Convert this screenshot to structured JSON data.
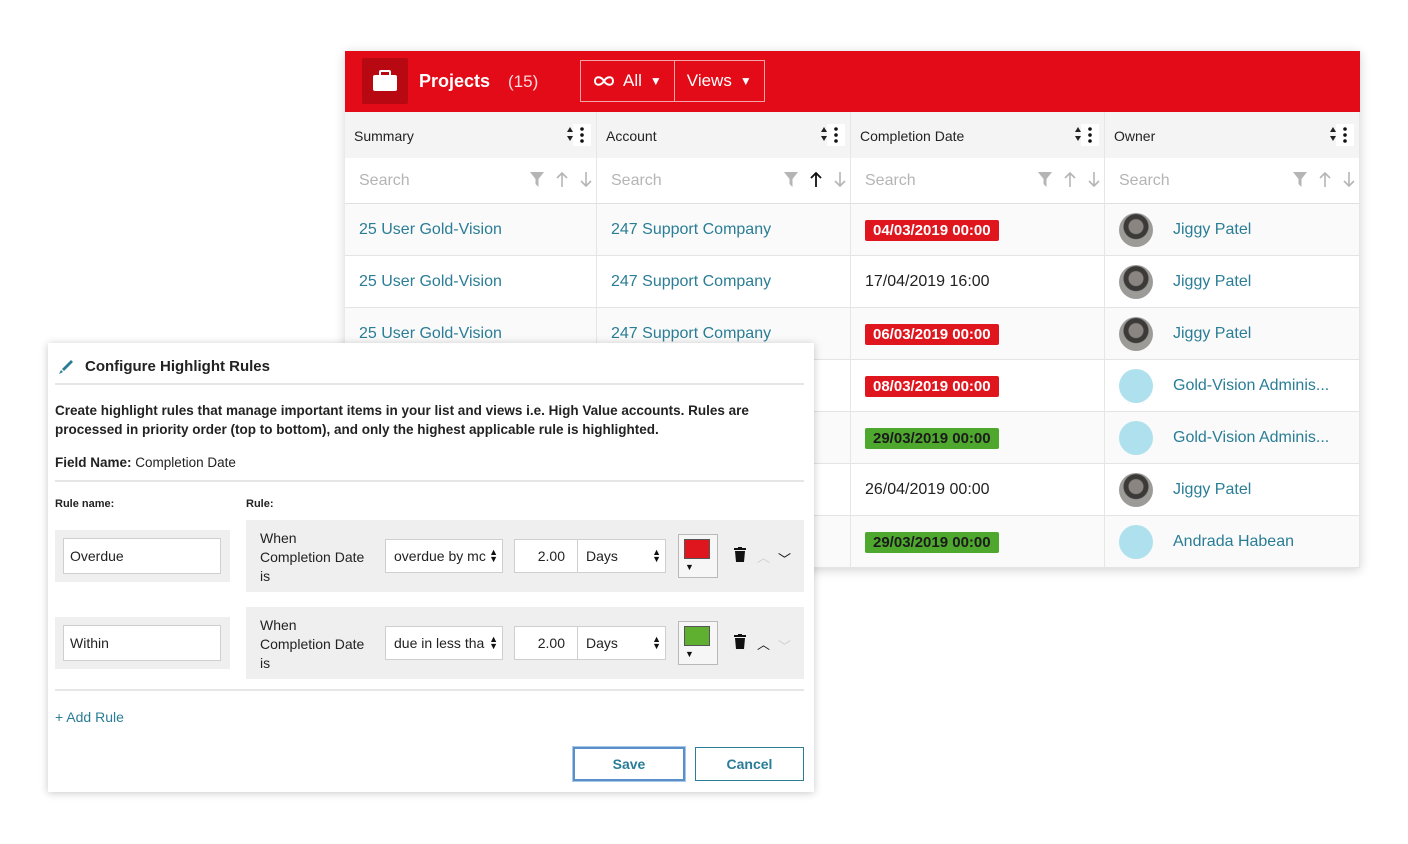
{
  "header": {
    "title": "Projects",
    "count": "(15)",
    "filter_label": "All",
    "views_label": "Views",
    "color": "#e20b17"
  },
  "columns": [
    {
      "label": "Summary",
      "search_placeholder": "Search"
    },
    {
      "label": "Account",
      "search_placeholder": "Search"
    },
    {
      "label": "Completion Date",
      "search_placeholder": "Search"
    },
    {
      "label": "Owner",
      "search_placeholder": "Search"
    }
  ],
  "rows": [
    {
      "summary": "25 User Gold-Vision",
      "account": "247 Support Company",
      "date": "04/03/2019 00:00",
      "highlight": "red",
      "owner": "Jiggy Patel",
      "avatar": "photo"
    },
    {
      "summary": "25 User Gold-Vision",
      "account": "247 Support Company",
      "date": "17/04/2019 16:00",
      "highlight": "none",
      "owner": "Jiggy Patel",
      "avatar": "photo"
    },
    {
      "summary": "25 User Gold-Vision",
      "account": "247 Support Company",
      "date": "06/03/2019 00:00",
      "highlight": "red",
      "owner": "Jiggy Patel",
      "avatar": "photo"
    },
    {
      "summary": "",
      "account": "",
      "date": "08/03/2019 00:00",
      "highlight": "red",
      "owner": "Gold-Vision Adminis...",
      "avatar": "blank"
    },
    {
      "summary": "",
      "account": "",
      "date": "29/03/2019 00:00",
      "highlight": "green",
      "owner": "Gold-Vision Adminis...",
      "avatar": "blank"
    },
    {
      "summary": "",
      "account": "",
      "date": "26/04/2019 00:00",
      "highlight": "none",
      "owner": "Jiggy Patel",
      "avatar": "photo"
    },
    {
      "summary": "",
      "account": "",
      "date": "29/03/2019 00:00",
      "highlight": "green",
      "owner": "Andrada Habean",
      "avatar": "blank"
    }
  ],
  "colors": {
    "red": "#e0161e",
    "green": "#4fa82e",
    "link": "#2a7d96"
  },
  "dialog": {
    "title": "Configure Highlight Rules",
    "description": "Create highlight rules that manage important items in your list and views i.e. High Value accounts. Rules are processed in priority order (top to bottom), and only the highest applicable rule is highlighted.",
    "field_name_label": "Field Name:",
    "field_name_value": "Completion Date",
    "rule_name_header": "Rule name:",
    "rule_header": "Rule:",
    "rules": [
      {
        "name": "Overdue",
        "when_line1": "When",
        "when_line2": "Completion Date",
        "when_line3": "is",
        "condition": "overdue by mc",
        "amount": "2.00",
        "unit": "Days",
        "color": "#e0161e"
      },
      {
        "name": "Within",
        "when_line1": "When",
        "when_line2": "Completion Date",
        "when_line3": "is",
        "condition": "due in less tha",
        "amount": "2.00",
        "unit": "Days",
        "color": "#5fb030"
      }
    ],
    "add_rule": "+ Add Rule",
    "save": "Save",
    "cancel": "Cancel"
  }
}
